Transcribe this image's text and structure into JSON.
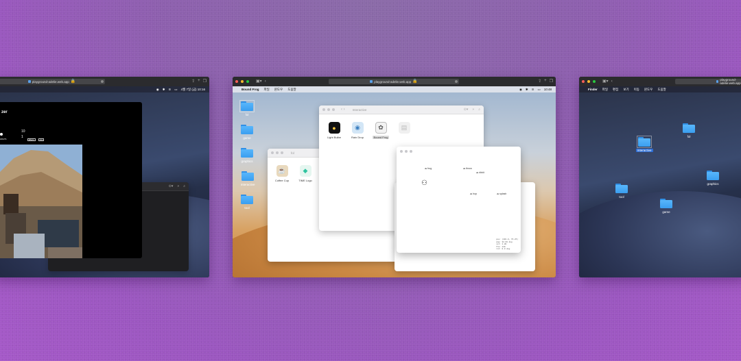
{
  "colors": {
    "accent": "#2f6fd6",
    "folder": "#3a9ef0",
    "background": "#9b56c0"
  },
  "left": {
    "url": "playground-adelie.web.app",
    "clock": "4월 7일 (금) 10:16",
    "viz": {
      "title": "zer",
      "num_top": "10",
      "num_bottom": "1",
      "label_small": "ZZLPS",
      "btn1": "Effects",
      "btn2": "Img"
    }
  },
  "center": {
    "url": "playground-adelie.web.app",
    "menubar": {
      "app": "Bound Frog",
      "items": [
        "파일",
        "윈도우",
        "도움말"
      ],
      "clock": "10:48"
    },
    "desktop_folders": [
      "fol",
      "game",
      "graphics",
      "interactive",
      "tool"
    ],
    "fol_window_title": "fol",
    "fol_apps": [
      "Coffee Cup",
      "TIME Logo"
    ],
    "interactive_window_title": "Interactive",
    "interactive_apps": [
      "Light Bulbe",
      "Rain Drop",
      "Bound Frog"
    ],
    "canvas": {
      "labels": [
        "frog",
        "throw",
        "ribbit",
        "hop",
        "splash",
        "croak"
      ],
      "readout": [
        "pos: (401.0, 76.25)",
        "ang: 32.09 deg",
        "vel: 1.80",
        "frm: 140",
        "rot: 0.0 deg"
      ]
    }
  },
  "right": {
    "url": "playground-adelie.web.app",
    "menubar": {
      "app": "Finder",
      "items": [
        "파일",
        "편집",
        "보기",
        "이동",
        "윈도우",
        "도움말"
      ]
    },
    "folders": {
      "interactive": "interactive",
      "fol": "fol",
      "tool": "tool",
      "graphics": "graphics",
      "game": "game"
    }
  }
}
